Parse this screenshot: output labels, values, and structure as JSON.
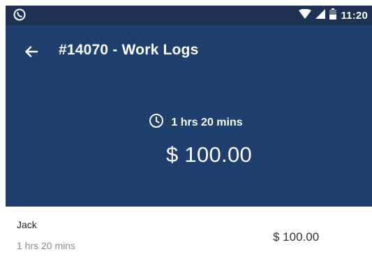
{
  "status_bar": {
    "left_icon": "whatsapp-icon",
    "icons": [
      "wifi-icon",
      "signal-icon",
      "battery-icon"
    ],
    "time": "11:20"
  },
  "app_bar": {
    "back_icon": "arrow-left-icon",
    "title": "#14070 - Work Logs"
  },
  "summary": {
    "clock_icon": "clock-icon",
    "total_time": "1 hrs 20 mins",
    "total_amount": "$ 100.00"
  },
  "work_logs": [
    {
      "name": "Jack",
      "duration": "1 hrs 20 mins",
      "amount": "$ 100.00"
    }
  ],
  "colors": {
    "status_bar_bg": "#1e3255",
    "app_bar_bg": "#1f3f6e",
    "divider": "#1e3a78",
    "secondary_text": "#8a8a8a"
  }
}
